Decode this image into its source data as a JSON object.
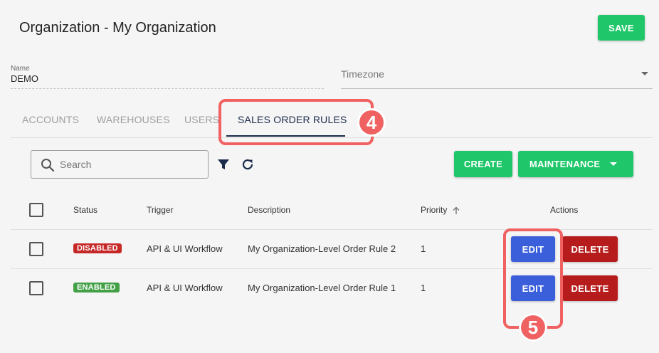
{
  "header": {
    "title": "Organization - My Organization",
    "save_label": "SAVE"
  },
  "form": {
    "name_label": "Name",
    "name_value": "DEMO",
    "timezone_label": "Timezone"
  },
  "tabs": [
    {
      "label": "ACCOUNTS"
    },
    {
      "label": "WAREHOUSES"
    },
    {
      "label": "USERS"
    },
    {
      "label": "SALES ORDER RULES"
    }
  ],
  "toolbar": {
    "search_placeholder": "Search",
    "create_label": "CREATE",
    "maintenance_label": "MAINTENANCE"
  },
  "table": {
    "columns": {
      "status": "Status",
      "trigger": "Trigger",
      "description": "Description",
      "priority": "Priority",
      "actions": "Actions"
    },
    "rows": [
      {
        "status": "DISABLED",
        "trigger": "API & UI Workflow",
        "description": "My Organization-Level Order Rule 2",
        "priority": "1",
        "edit_label": "EDIT",
        "delete_label": "DELETE"
      },
      {
        "status": "ENABLED",
        "trigger": "API & UI Workflow",
        "description": "My Organization-Level Order Rule 1",
        "priority": "1",
        "edit_label": "EDIT",
        "delete_label": "DELETE"
      }
    ]
  },
  "callouts": {
    "tabs_step": "4",
    "edit_step": "5"
  },
  "colors": {
    "green": "#1fc76a",
    "blue": "#3b5fdb",
    "red": "#b71c1c",
    "callout": "#f06262"
  }
}
